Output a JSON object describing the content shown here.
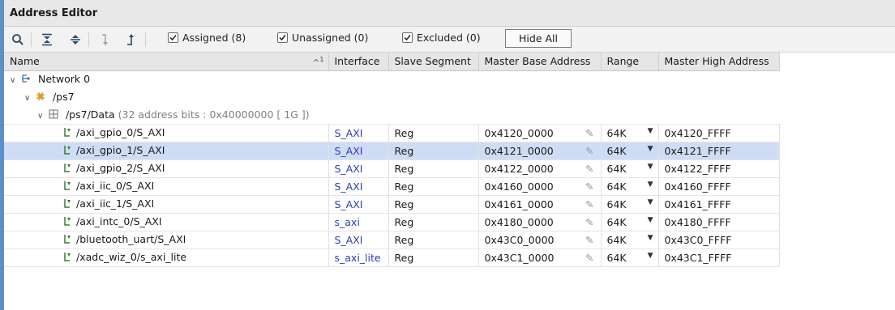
{
  "window": {
    "title": "Address Editor"
  },
  "toolbar": {
    "buttons": [
      "search-icon",
      "collapse-all-icon",
      "expand-all-icon",
      "move-down-icon",
      "move-up-icon"
    ],
    "filters": [
      {
        "label": "Assigned (8)",
        "checked": true
      },
      {
        "label": "Unassigned (0)",
        "checked": true
      },
      {
        "label": "Excluded (0)",
        "checked": true
      }
    ],
    "hide_all_label": "Hide All"
  },
  "table": {
    "columns": {
      "name": "Name",
      "sort_indicator": "1",
      "interface": "Interface",
      "slave_segment": "Slave Segment",
      "master_base": "Master Base Address",
      "range": "Range",
      "master_high": "Master High Address"
    },
    "tree": {
      "network": "Network 0",
      "ps7": "/ps7",
      "data": "/ps7/Data",
      "data_detail": "(32 address bits : 0x40000000 [ 1G ])"
    },
    "rows": [
      {
        "name": "/axi_gpio_0/S_AXI",
        "interface": "S_AXI",
        "segment": "Reg",
        "base": "0x4120_0000",
        "range": "64K",
        "high": "0x4120_FFFF"
      },
      {
        "name": "/axi_gpio_1/S_AXI",
        "interface": "S_AXI",
        "segment": "Reg",
        "base": "0x4121_0000",
        "range": "64K",
        "high": "0x4121_FFFF"
      },
      {
        "name": "/axi_gpio_2/S_AXI",
        "interface": "S_AXI",
        "segment": "Reg",
        "base": "0x4122_0000",
        "range": "64K",
        "high": "0x4122_FFFF"
      },
      {
        "name": "/axi_iic_0/S_AXI",
        "interface": "S_AXI",
        "segment": "Reg",
        "base": "0x4160_0000",
        "range": "64K",
        "high": "0x4160_FFFF"
      },
      {
        "name": "/axi_iic_1/S_AXI",
        "interface": "S_AXI",
        "segment": "Reg",
        "base": "0x4161_0000",
        "range": "64K",
        "high": "0x4161_FFFF"
      },
      {
        "name": "/axi_intc_0/S_AXI",
        "interface": "s_axi",
        "segment": "Reg",
        "base": "0x4180_0000",
        "range": "64K",
        "high": "0x4180_FFFF"
      },
      {
        "name": "/bluetooth_uart/S_AXI",
        "interface": "S_AXI",
        "segment": "Reg",
        "base": "0x43C0_0000",
        "range": "64K",
        "high": "0x43C0_FFFF"
      },
      {
        "name": "/xadc_wiz_0/s_axi_lite",
        "interface": "s_axi_lite",
        "segment": "Reg",
        "base": "0x43C1_0000",
        "range": "64K",
        "high": "0x43C1_FFFF"
      }
    ],
    "selected_row": 1
  },
  "colors": {
    "selection": "#cfdcf5",
    "link": "#2a3fb0",
    "accent": "#5d8fc9"
  }
}
